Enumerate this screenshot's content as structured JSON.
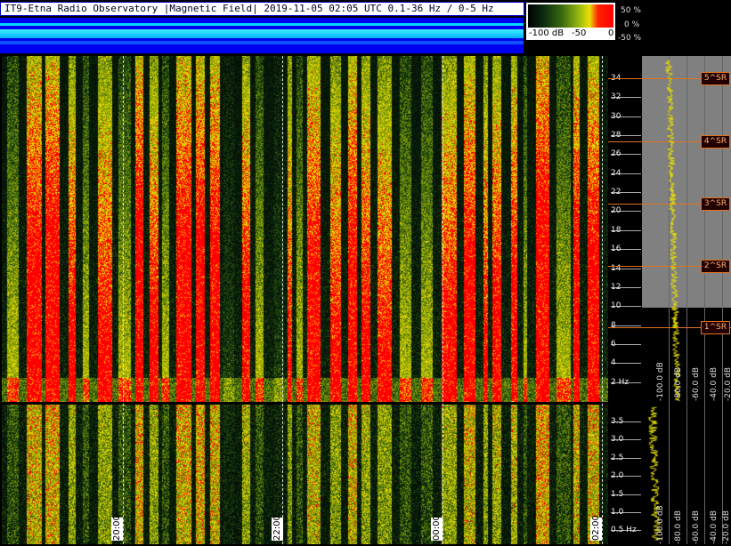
{
  "title": "IT9-Etna Radio Observatory |Magnetic Field| 2019-11-05 02:05 UTC 0.1-36 Hz / 0-5 Hz",
  "legend": {
    "left_label": "-100 dB",
    "mid_label": "-50",
    "right_label": "0",
    "pct_top": "50 %",
    "pct_mid": "0 %",
    "pct_bot": "-50 %"
  },
  "upper_axis": {
    "ticks": [
      "34",
      "32",
      "30",
      "28",
      "26",
      "24",
      "22",
      "20",
      "18",
      "16",
      "14",
      "12",
      "10",
      "8",
      "6",
      "4",
      "2 Hz"
    ]
  },
  "lower_axis": {
    "ticks": [
      "3.5",
      "3.0",
      "2.5",
      "2.0",
      "1.5",
      "1.0",
      "0.5 Hz"
    ]
  },
  "schumann": [
    "5^SR",
    "4^SR",
    "3^SR",
    "2^SR",
    "1^SR"
  ],
  "db_labels_upper": [
    "-100.0 dB",
    "-80.0 dB",
    "-60.0 dB"
  ],
  "db_labels_lower": [
    "-100.0 dB",
    "-80.0 dB",
    "-60.0 dB",
    "-40.0 dB",
    "-20.0 dB"
  ],
  "db_labels_upper_right": [
    "-40.0 dB",
    "-20.0 dB"
  ],
  "time_labels": [
    "20:00",
    "22:00",
    "00:00",
    "02:00"
  ],
  "colors": {
    "background": "#000000",
    "signal_red": "#ff0000",
    "signal_yellow": "#e8e000",
    "noise_green": "#3a6a10",
    "schumann_line": "#e07020",
    "trace": "#e8e000"
  }
}
